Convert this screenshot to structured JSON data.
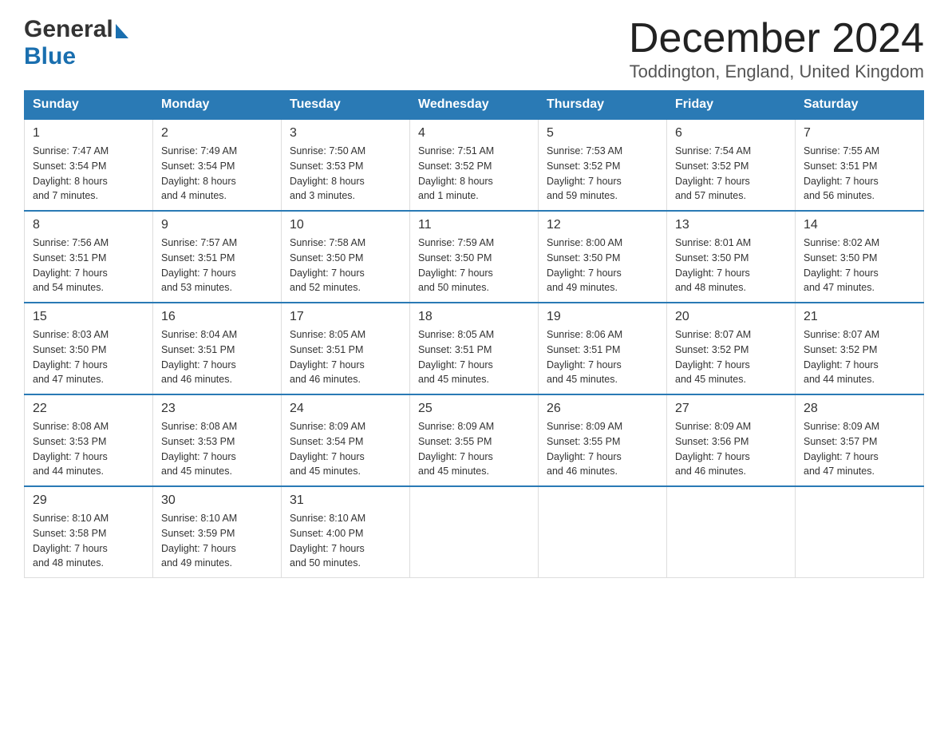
{
  "header": {
    "logo_general": "General",
    "logo_blue": "Blue",
    "main_title": "December 2024",
    "subtitle": "Toddington, England, United Kingdom"
  },
  "days_of_week": [
    "Sunday",
    "Monday",
    "Tuesday",
    "Wednesday",
    "Thursday",
    "Friday",
    "Saturday"
  ],
  "weeks": [
    [
      {
        "day": "1",
        "sunrise": "7:47 AM",
        "sunset": "3:54 PM",
        "daylight": "8 hours and 7 minutes."
      },
      {
        "day": "2",
        "sunrise": "7:49 AM",
        "sunset": "3:54 PM",
        "daylight": "8 hours and 4 minutes."
      },
      {
        "day": "3",
        "sunrise": "7:50 AM",
        "sunset": "3:53 PM",
        "daylight": "8 hours and 3 minutes."
      },
      {
        "day": "4",
        "sunrise": "7:51 AM",
        "sunset": "3:52 PM",
        "daylight": "8 hours and 1 minute."
      },
      {
        "day": "5",
        "sunrise": "7:53 AM",
        "sunset": "3:52 PM",
        "daylight": "7 hours and 59 minutes."
      },
      {
        "day": "6",
        "sunrise": "7:54 AM",
        "sunset": "3:52 PM",
        "daylight": "7 hours and 57 minutes."
      },
      {
        "day": "7",
        "sunrise": "7:55 AM",
        "sunset": "3:51 PM",
        "daylight": "7 hours and 56 minutes."
      }
    ],
    [
      {
        "day": "8",
        "sunrise": "7:56 AM",
        "sunset": "3:51 PM",
        "daylight": "7 hours and 54 minutes."
      },
      {
        "day": "9",
        "sunrise": "7:57 AM",
        "sunset": "3:51 PM",
        "daylight": "7 hours and 53 minutes."
      },
      {
        "day": "10",
        "sunrise": "7:58 AM",
        "sunset": "3:50 PM",
        "daylight": "7 hours and 52 minutes."
      },
      {
        "day": "11",
        "sunrise": "7:59 AM",
        "sunset": "3:50 PM",
        "daylight": "7 hours and 50 minutes."
      },
      {
        "day": "12",
        "sunrise": "8:00 AM",
        "sunset": "3:50 PM",
        "daylight": "7 hours and 49 minutes."
      },
      {
        "day": "13",
        "sunrise": "8:01 AM",
        "sunset": "3:50 PM",
        "daylight": "7 hours and 48 minutes."
      },
      {
        "day": "14",
        "sunrise": "8:02 AM",
        "sunset": "3:50 PM",
        "daylight": "7 hours and 47 minutes."
      }
    ],
    [
      {
        "day": "15",
        "sunrise": "8:03 AM",
        "sunset": "3:50 PM",
        "daylight": "7 hours and 47 minutes."
      },
      {
        "day": "16",
        "sunrise": "8:04 AM",
        "sunset": "3:51 PM",
        "daylight": "7 hours and 46 minutes."
      },
      {
        "day": "17",
        "sunrise": "8:05 AM",
        "sunset": "3:51 PM",
        "daylight": "7 hours and 46 minutes."
      },
      {
        "day": "18",
        "sunrise": "8:05 AM",
        "sunset": "3:51 PM",
        "daylight": "7 hours and 45 minutes."
      },
      {
        "day": "19",
        "sunrise": "8:06 AM",
        "sunset": "3:51 PM",
        "daylight": "7 hours and 45 minutes."
      },
      {
        "day": "20",
        "sunrise": "8:07 AM",
        "sunset": "3:52 PM",
        "daylight": "7 hours and 45 minutes."
      },
      {
        "day": "21",
        "sunrise": "8:07 AM",
        "sunset": "3:52 PM",
        "daylight": "7 hours and 44 minutes."
      }
    ],
    [
      {
        "day": "22",
        "sunrise": "8:08 AM",
        "sunset": "3:53 PM",
        "daylight": "7 hours and 44 minutes."
      },
      {
        "day": "23",
        "sunrise": "8:08 AM",
        "sunset": "3:53 PM",
        "daylight": "7 hours and 45 minutes."
      },
      {
        "day": "24",
        "sunrise": "8:09 AM",
        "sunset": "3:54 PM",
        "daylight": "7 hours and 45 minutes."
      },
      {
        "day": "25",
        "sunrise": "8:09 AM",
        "sunset": "3:55 PM",
        "daylight": "7 hours and 45 minutes."
      },
      {
        "day": "26",
        "sunrise": "8:09 AM",
        "sunset": "3:55 PM",
        "daylight": "7 hours and 46 minutes."
      },
      {
        "day": "27",
        "sunrise": "8:09 AM",
        "sunset": "3:56 PM",
        "daylight": "7 hours and 46 minutes."
      },
      {
        "day": "28",
        "sunrise": "8:09 AM",
        "sunset": "3:57 PM",
        "daylight": "7 hours and 47 minutes."
      }
    ],
    [
      {
        "day": "29",
        "sunrise": "8:10 AM",
        "sunset": "3:58 PM",
        "daylight": "7 hours and 48 minutes."
      },
      {
        "day": "30",
        "sunrise": "8:10 AM",
        "sunset": "3:59 PM",
        "daylight": "7 hours and 49 minutes."
      },
      {
        "day": "31",
        "sunrise": "8:10 AM",
        "sunset": "4:00 PM",
        "daylight": "7 hours and 50 minutes."
      },
      null,
      null,
      null,
      null
    ]
  ],
  "labels": {
    "sunrise": "Sunrise:",
    "sunset": "Sunset:",
    "daylight": "Daylight:"
  }
}
